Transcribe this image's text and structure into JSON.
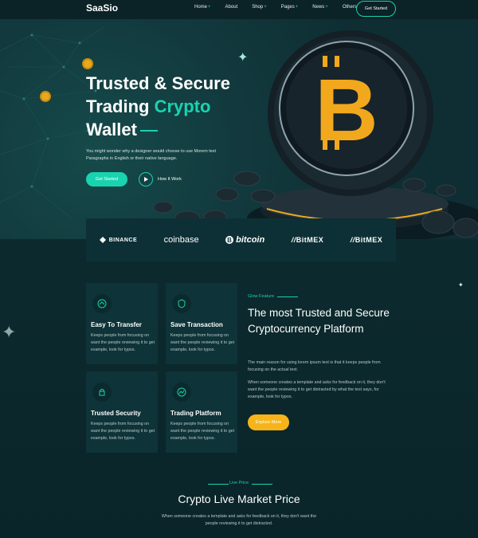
{
  "brand": {
    "logo": "SaaSio"
  },
  "nav": {
    "items": [
      {
        "label": "Home",
        "has_sub": true
      },
      {
        "label": "About",
        "has_sub": false
      },
      {
        "label": "Shop",
        "has_sub": true
      },
      {
        "label": "Pages",
        "has_sub": true
      },
      {
        "label": "News",
        "has_sub": true
      },
      {
        "label": "Others",
        "has_sub": true
      }
    ],
    "cta": "Get Started",
    "sub_marker": "+"
  },
  "hero": {
    "title_line1": "Trusted & Secure",
    "title_line2a": "Trading ",
    "title_line2b": "Crypto",
    "title_line3": "Wallet",
    "description": "You might wonder why a designer would choose to use Morem text Paragraphs in English or their native language.",
    "cta": "Get Started",
    "play_label": "How It Work"
  },
  "partners": [
    "BINANCE",
    "coinbase",
    "bitcoin",
    "BitMEX",
    "BitMEX"
  ],
  "features": {
    "cards": [
      {
        "title": "Easy To Transfer",
        "text": "Keeps people from focusing on want the people reviewing it to get example, look for typos."
      },
      {
        "title": "Save Transaction",
        "text": "Keeps people from focusing on want the people reviewing it to get example, look for typos."
      },
      {
        "title": "Trusted Security",
        "text": "Keeps people from focusing on want the people reviewing it to get example, look for typos."
      },
      {
        "title": "Trading Platform",
        "text": "Keeps people from focusing on want the people reviewing it to get example, look for typos."
      }
    ],
    "tag": "Glow Feature",
    "title": "The most Trusted and Secure Cryptocurrency Platform",
    "p1": "The main reason for using lorem ipsum text is that it keeps people from focusing on the actual text.",
    "p2": "When someone creates a template and asks for feedback on it, they don't want the people reviewing it to get distracted by what the text says, for example, look for typos.",
    "cta": "Explore More"
  },
  "live_price": {
    "tag": "Live Price",
    "title": "Crypto Live Market Price",
    "description": "When someone creates a template and asks for feedback on it, they don't want the people reviewing it to get distracted."
  },
  "colors": {
    "accent": "#19d3b0",
    "gold": "#f6b41a",
    "background": "#0c2a2e"
  }
}
